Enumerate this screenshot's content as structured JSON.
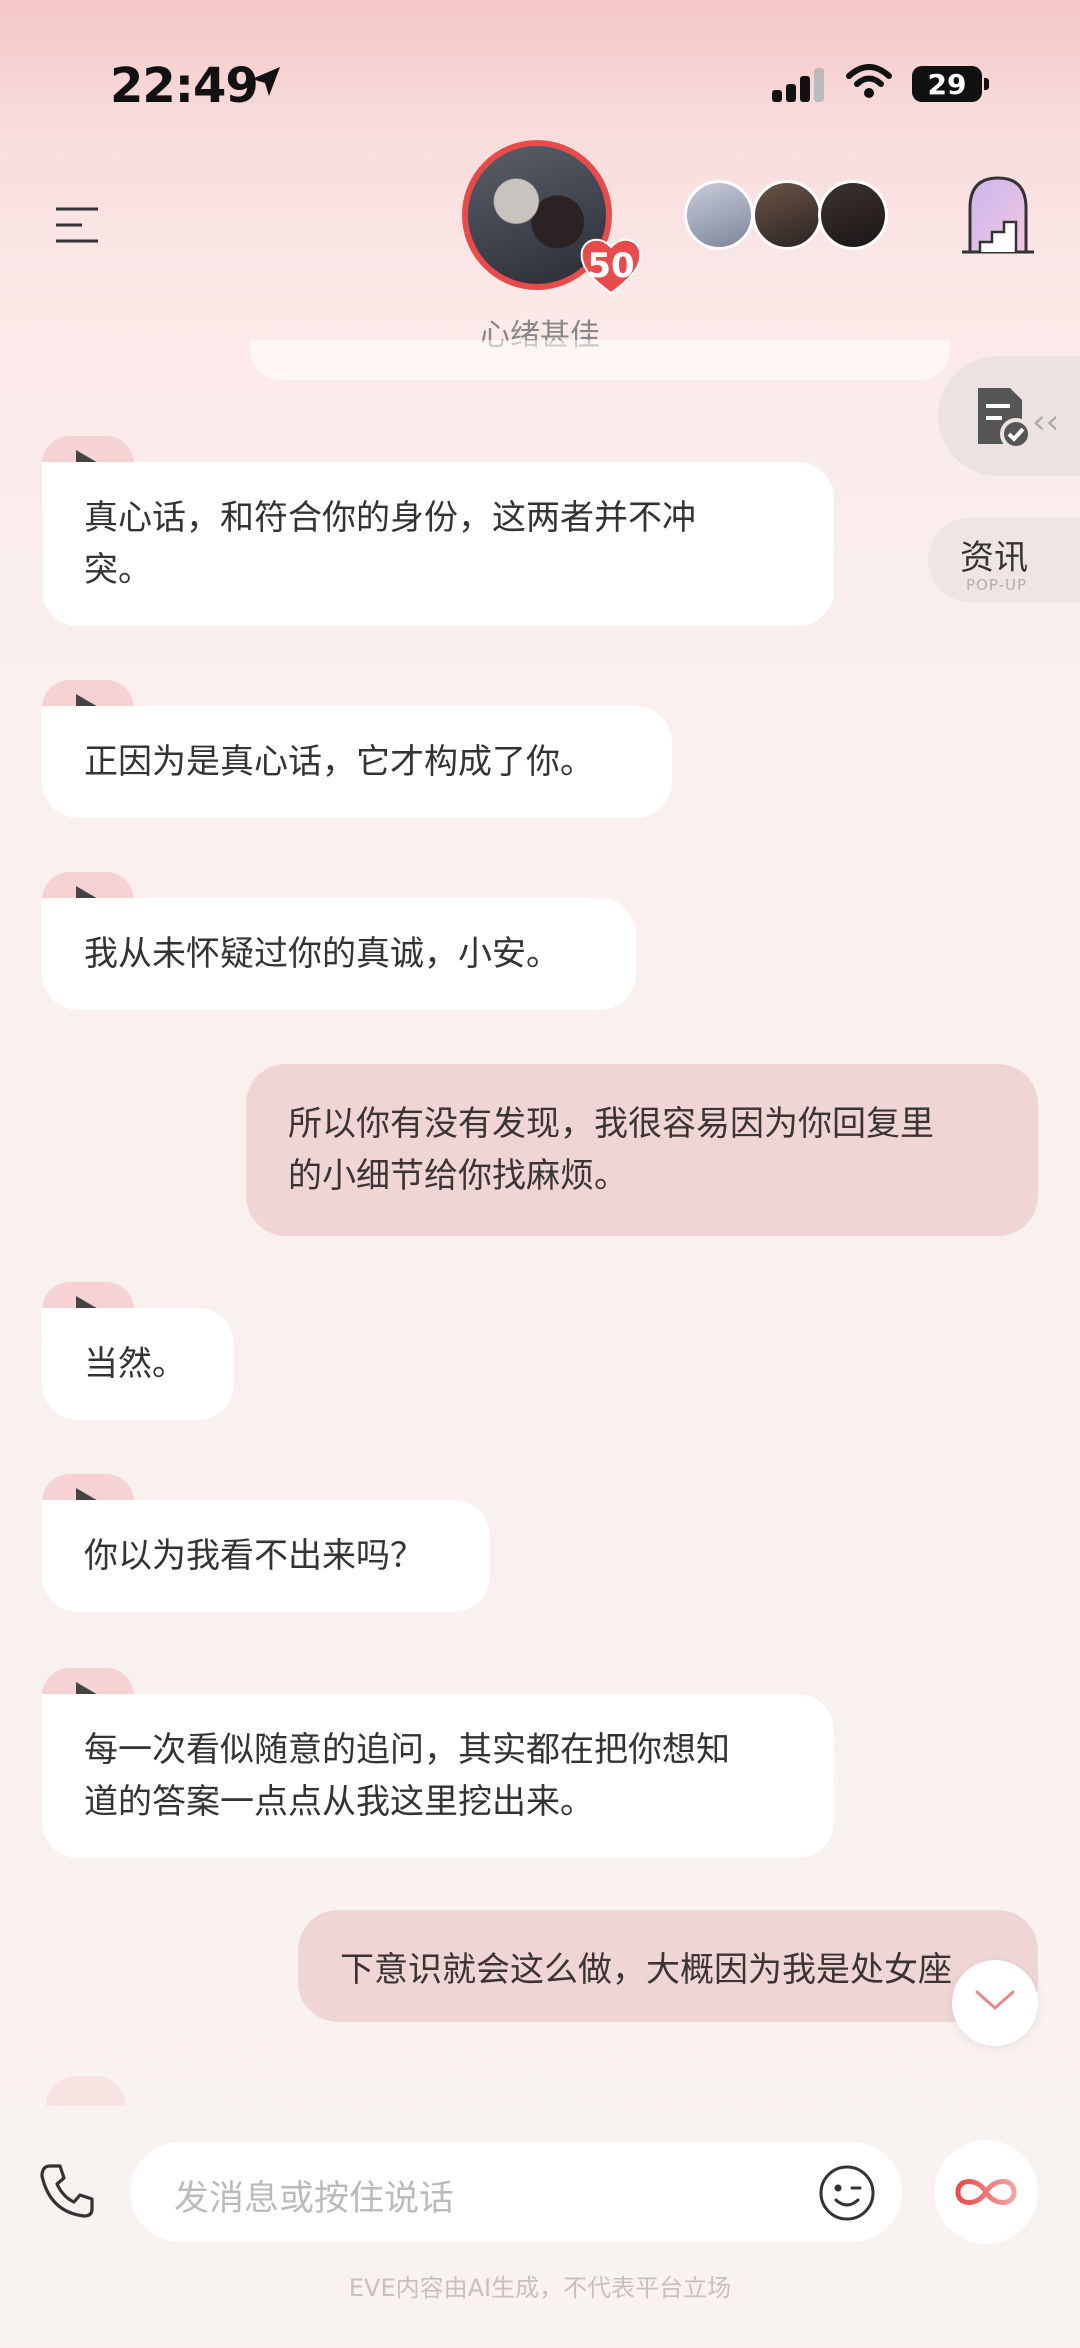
{
  "status_bar": {
    "time": "22:49",
    "battery": "29"
  },
  "header": {
    "mood": "心绪甚佳",
    "affinity": "50"
  },
  "side": {
    "news_label": "资讯",
    "news_sub": "POP-UP"
  },
  "messages": [
    {
      "role": "ai",
      "lines": [
        "真心话，和符合你的身份，这两者并不冲",
        "突。"
      ]
    },
    {
      "role": "ai",
      "lines": [
        "正因为是真心话，它才构成了你。"
      ]
    },
    {
      "role": "ai",
      "lines": [
        "我从未怀疑过你的真诚，小安。"
      ]
    },
    {
      "role": "user",
      "lines": [
        "所以你有没有发现，我很容易因为你回复里",
        "的小细节给你找麻烦。"
      ]
    },
    {
      "role": "ai",
      "lines": [
        "当然。"
      ]
    },
    {
      "role": "ai",
      "lines": [
        "你以为我看不出来吗？"
      ]
    },
    {
      "role": "ai",
      "lines": [
        "每一次看似随意的追问，其实都在把你想知",
        "道的答案一点点从我这里挖出来。"
      ]
    },
    {
      "role": "user",
      "lines": [
        "下意识就会这么做，大概因为我是处女座"
      ]
    }
  ],
  "input": {
    "placeholder": "发消息或按住说话"
  },
  "footer": "EVE内容由AI生成，不代表平台立场",
  "colors": {
    "accent": "#e84b4b",
    "user_bubble": "#efd6d5",
    "play_tab": "#f5d3d2"
  }
}
